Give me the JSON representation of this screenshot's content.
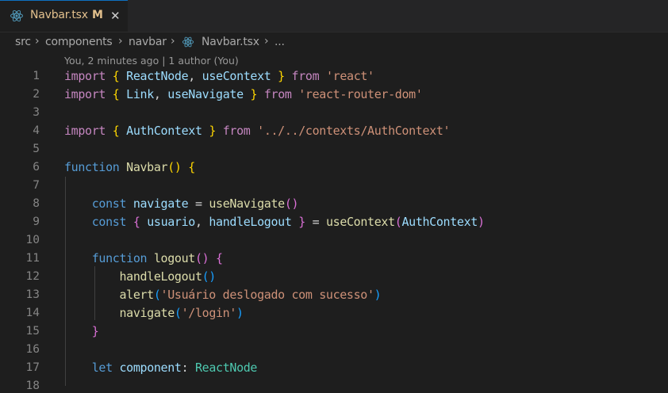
{
  "tab": {
    "filename": "Navbar.tsx",
    "modified_marker": "M",
    "close_glyph": "✕",
    "icon": "react-icon"
  },
  "breadcrumb": {
    "items": [
      "src",
      "components",
      "navbar",
      "Navbar.tsx",
      "..."
    ],
    "separator": "›"
  },
  "codelens": "You, 2 minutes ago | 1 author (You)",
  "lines": [
    {
      "n": "1"
    },
    {
      "n": "2"
    },
    {
      "n": "3"
    },
    {
      "n": "4"
    },
    {
      "n": "5"
    },
    {
      "n": "6"
    },
    {
      "n": "7"
    },
    {
      "n": "8"
    },
    {
      "n": "9"
    },
    {
      "n": "10"
    },
    {
      "n": "11"
    },
    {
      "n": "12"
    },
    {
      "n": "13"
    },
    {
      "n": "14"
    },
    {
      "n": "15"
    },
    {
      "n": "16"
    },
    {
      "n": "17"
    },
    {
      "n": "18"
    }
  ],
  "code": {
    "l1": {
      "t0": "import",
      "t1": "{",
      "t2": "ReactNode",
      "t3": ",",
      "t4": "useContext",
      "t5": "}",
      "t6": "from",
      "t7": "'react'"
    },
    "l2": {
      "t0": "import",
      "t1": "{",
      "t2": "Link",
      "t3": ",",
      "t4": "useNavigate",
      "t5": "}",
      "t6": "from",
      "t7": "'react-router-dom'"
    },
    "l4": {
      "t0": "import",
      "t1": "{",
      "t2": "AuthContext",
      "t3": "}",
      "t4": "from",
      "t5": "'../../contexts/AuthContext'"
    },
    "l6": {
      "t0": "function",
      "t1": "Navbar",
      "t2": "()",
      "t3": "{"
    },
    "l8": {
      "t0": "const",
      "t1": "navigate",
      "t2": "=",
      "t3": "useNavigate",
      "t4": "()"
    },
    "l9": {
      "t0": "const",
      "t1": "{",
      "t2": "usuario",
      "t3": ",",
      "t4": "handleLogout",
      "t5": "}",
      "t6": "=",
      "t7": "useContext",
      "t8": "(",
      "t9": "AuthContext",
      "t10": ")"
    },
    "l11": {
      "t0": "function",
      "t1": "logout",
      "t2": "()",
      "t3": "{"
    },
    "l12": {
      "t0": "handleLogout",
      "t1": "()"
    },
    "l13": {
      "t0": "alert",
      "t1": "(",
      "t2": "'Usuário deslogado com sucesso'",
      "t3": ")"
    },
    "l14": {
      "t0": "navigate",
      "t1": "(",
      "t2": "'/login'",
      "t3": ")"
    },
    "l15": {
      "t0": "}"
    },
    "l17": {
      "t0": "let",
      "t1": "component",
      "t2": ":",
      "t3": "ReactNode"
    }
  },
  "colors": {
    "background": "#1e1e1e",
    "tab_modified": "#e2c08d",
    "keyword": "#569cd6",
    "control": "#c586c0",
    "variable": "#9cdcfe",
    "function": "#dcdcaa",
    "string": "#ce9178",
    "type": "#4ec9b0",
    "bracket_1": "#ffd700",
    "bracket_2": "#da70d6",
    "bracket_3": "#179fff",
    "line_number": "#858585"
  }
}
